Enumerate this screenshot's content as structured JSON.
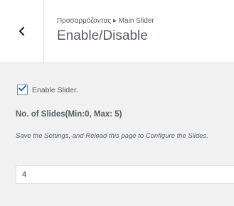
{
  "header": {
    "breadcrumb": "Προσαρμόζοντας ▸ Main Slider",
    "title": "Enable/Disable",
    "back_icon": "chevron-left-icon"
  },
  "settings": {
    "checkbox_label": "Enable Slider.",
    "checkbox_checked": true,
    "field_title": "No. of Slides(Min:0, Max: 5)",
    "description": "Save the Settings, and Reload this page to Configure the Slides.",
    "slides_value": "4"
  },
  "colors": {
    "accent": "#2271b1",
    "text": "#555d66",
    "panel_bg": "#f1f1f1"
  }
}
